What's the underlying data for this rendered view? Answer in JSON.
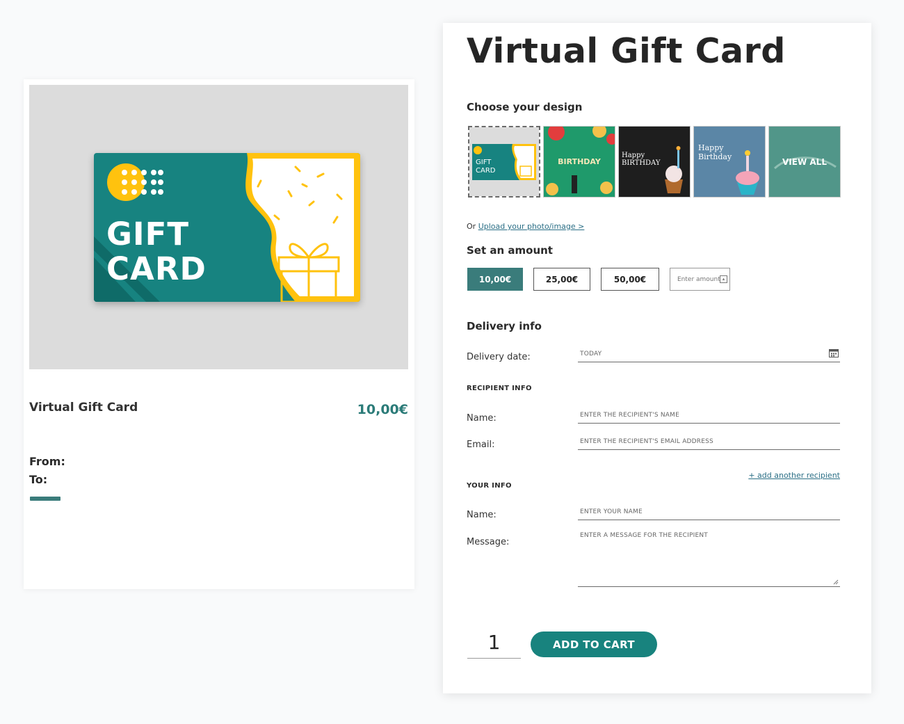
{
  "preview": {
    "card_title": "GIFT\nCARD",
    "product_name": "Virtual Gift Card",
    "price": "10,00€",
    "from_label": "From:",
    "to_label": "To:"
  },
  "form": {
    "title": "Virtual Gift Card",
    "design_section": "Choose your design",
    "designs": [
      {
        "label": "GIFT\nCARD",
        "selected": true
      },
      {
        "label": "BIRTHDAY",
        "selected": false
      },
      {
        "label": "Happy BIRTHDAY",
        "selected": false
      },
      {
        "label": "Happy Birthday",
        "selected": false
      },
      {
        "label": "VIEW ALL",
        "selected": false
      }
    ],
    "upload_prefix": "Or",
    "upload_link": "Upload your photo/image >",
    "amount_section": "Set an amount",
    "amounts": [
      "10,00€",
      "25,00€",
      "50,00€"
    ],
    "amount_placeholder": "Enter amount",
    "delivery_section": "Delivery info",
    "delivery_date_label": "Delivery date:",
    "delivery_date_value": "TODAY",
    "recipient_section": "RECIPIENT INFO",
    "recipient_name_label": "Name:",
    "recipient_name_placeholder": "ENTER THE RECIPIENT'S NAME",
    "recipient_email_label": "Email:",
    "recipient_email_placeholder": "ENTER THE RECIPIENT'S EMAIL ADDRESS",
    "add_recipient": "+ add another recipient",
    "your_section": "YOUR INFO",
    "your_name_label": "Name:",
    "your_name_placeholder": "ENTER YOUR NAME",
    "message_label": "Message:",
    "message_placeholder": "ENTER A MESSAGE FOR THE RECIPIENT",
    "quantity": "1",
    "add_to_cart": "ADD TO CART"
  },
  "colors": {
    "teal": "#18837e",
    "teal_dark": "#3a7c7b",
    "yellow": "#ffc20e",
    "link": "#2b6f86"
  },
  "icons": [
    "calendar-icon",
    "resize-handle-icon",
    "gift-box-icon",
    "confetti-icon"
  ]
}
